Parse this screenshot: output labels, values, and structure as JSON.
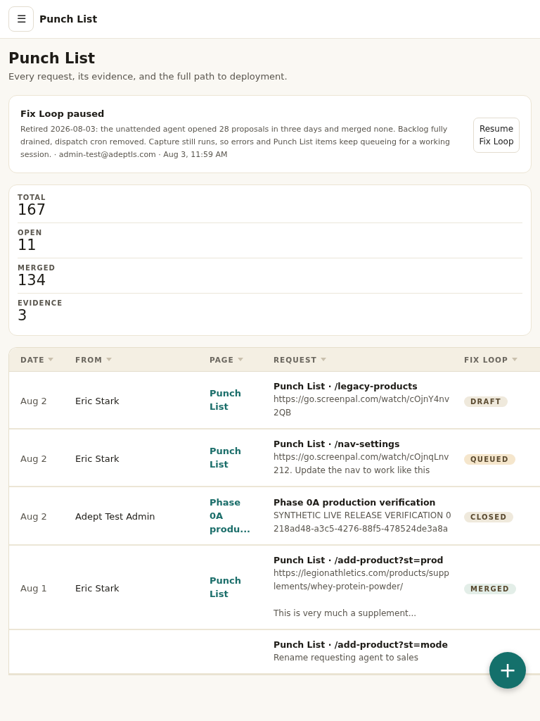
{
  "top_bar": {
    "menu_icon": "☰",
    "title": "Punch List"
  },
  "page": {
    "title": "Punch List",
    "subtitle": "Every request, its evidence, and the full path to deployment."
  },
  "notice": {
    "title": "Fix Loop paused",
    "text": "Retired 2026-08-03: the unattended agent opened 28 proposals in three days and merged none. Backlog fully drained, dispatch cron removed. Capture still runs, so errors and Punch List items keep queueing for a working session. · admin-test@adeptls.com · Aug 3, 11:59 AM",
    "button": "Resume Fix Loop"
  },
  "stats": [
    {
      "label": "TOTAL",
      "value": "167"
    },
    {
      "label": "OPEN",
      "value": "11"
    },
    {
      "label": "MERGED",
      "value": "134"
    },
    {
      "label": "EVIDENCE",
      "value": "3"
    }
  ],
  "table": {
    "columns": [
      "DATE",
      "FROM",
      "PAGE",
      "REQUEST",
      "FIX LOOP"
    ],
    "rows": [
      {
        "date": "Aug 2",
        "from": "Eric Stark",
        "page": "Punch List",
        "request_title": "Punch List · /legacy-products",
        "request_text": "https://go.screenpal.com/watch/cOjnY4nv2QB",
        "status": "DRAFT",
        "color": "#efe9dc"
      },
      {
        "date": "Aug 2",
        "from": "Eric Stark",
        "page": "Punch List",
        "request_title": "Punch List · /nav-settings",
        "request_text": "https://go.screenpal.com/watch/cOjnqLnv212. Update the nav to work like this",
        "status": "QUEUED",
        "color": "#f5e6cc"
      },
      {
        "date": "Aug 2",
        "from": "Adept Test Admin",
        "page": "Phase 0A produ...",
        "request_title": "Phase 0A production verification",
        "request_text": "SYNTHETIC LIVE RELEASE VERIFICATION 0218ad48-a3c5-4276-88f5-478524de3a8a",
        "status": "CLOSED",
        "color": "#efe9dc"
      },
      {
        "date": "Aug 1",
        "from": "Eric Stark",
        "page": "Punch List",
        "request_title": "Punch List · /add-product?st=prod",
        "request_text": "https://legionathletics.com/products/supplements/whey-protein-powder/\n\nThis is very much a supplement...",
        "status": "MERGED",
        "color": "#e3eee8"
      },
      {
        "request_title": "Punch List · /add-product?st=mode",
        "request_text": "Rename requesting agent to sales"
      }
    ]
  },
  "fab": {
    "label": "+"
  }
}
